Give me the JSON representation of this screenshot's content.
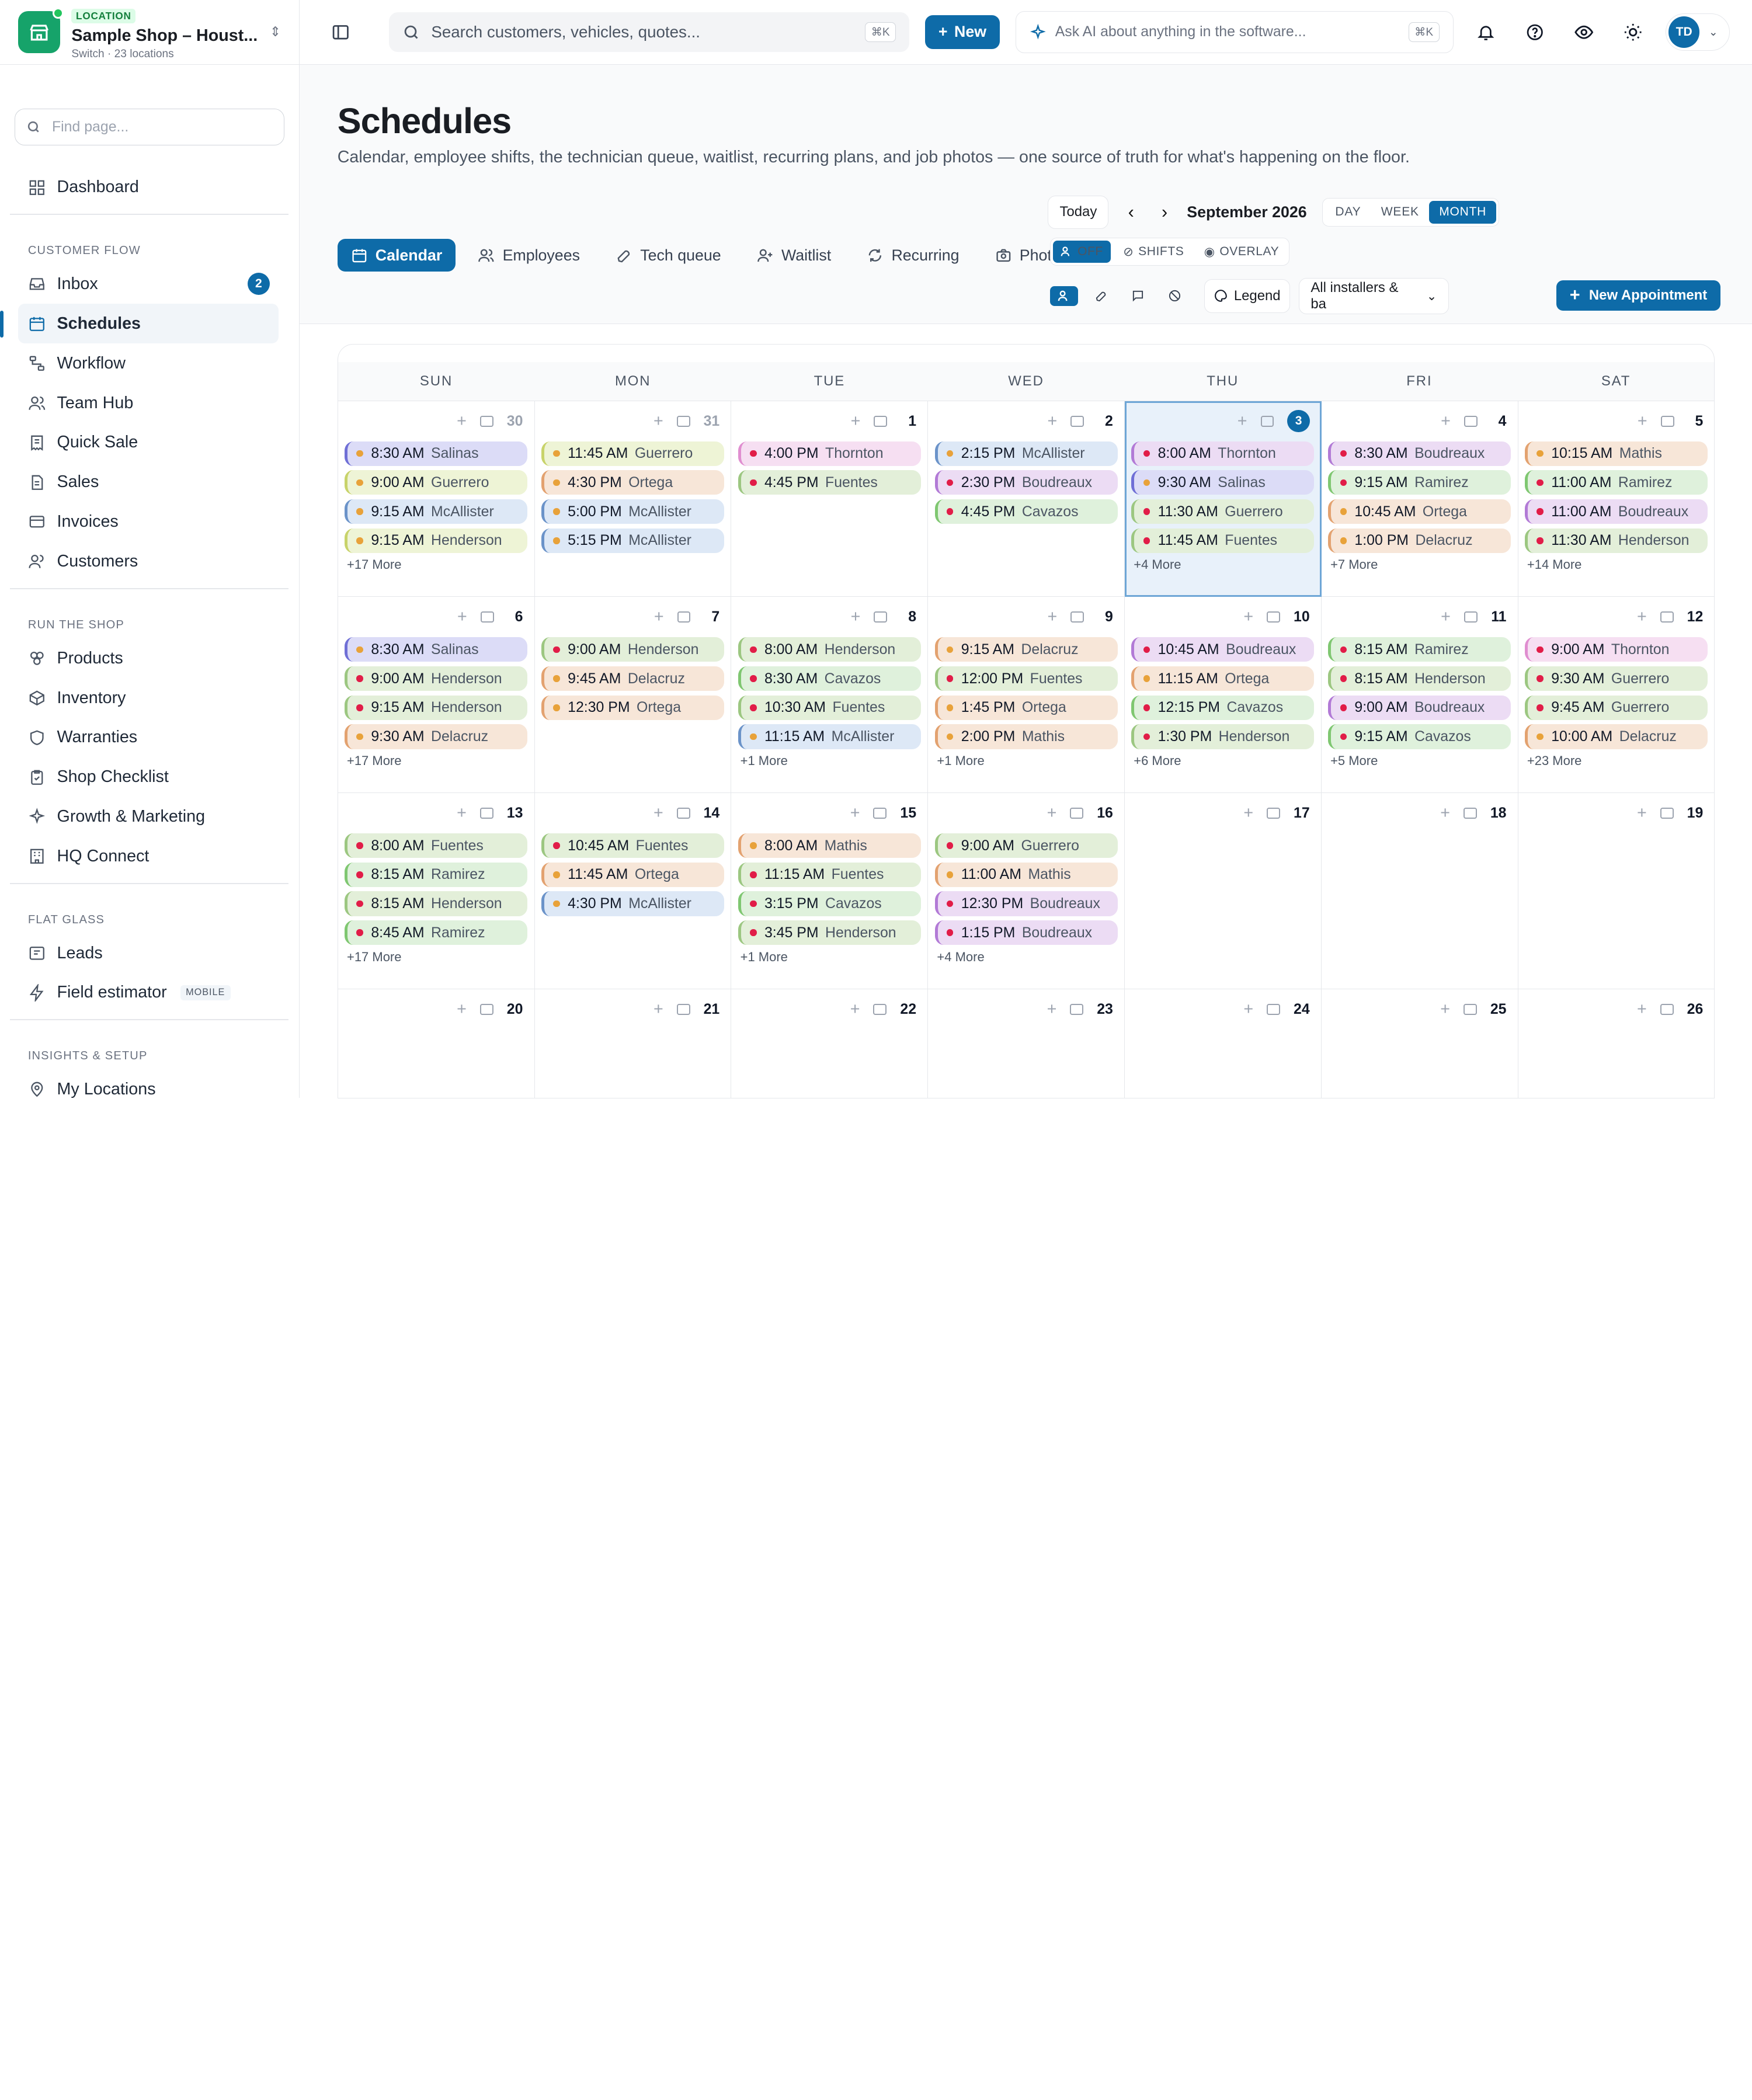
{
  "shop": {
    "badge": "LOCATION",
    "name": "Sample Shop – Houst...",
    "sub": "Switch · 23 locations"
  },
  "sidebar": {
    "find_placeholder": "Find page...",
    "top": [
      {
        "label": "Dashboard",
        "icon": "dashboard-icon"
      }
    ],
    "sections": [
      {
        "title": "CUSTOMER FLOW",
        "items": [
          {
            "label": "Inbox",
            "icon": "inbox-icon",
            "badge": "2"
          },
          {
            "label": "Schedules",
            "icon": "calendar-icon",
            "active": true
          },
          {
            "label": "Workflow",
            "icon": "workflow-icon"
          },
          {
            "label": "Team Hub",
            "icon": "users-icon"
          },
          {
            "label": "Quick Sale",
            "icon": "receipt-icon"
          },
          {
            "label": "Sales",
            "icon": "document-icon"
          },
          {
            "label": "Invoices",
            "icon": "card-icon"
          },
          {
            "label": "Customers",
            "icon": "customers-icon"
          }
        ]
      },
      {
        "title": "RUN THE SHOP",
        "items": [
          {
            "label": "Products",
            "icon": "products-icon"
          },
          {
            "label": "Inventory",
            "icon": "box-icon"
          },
          {
            "label": "Warranties",
            "icon": "shield-icon"
          },
          {
            "label": "Shop Checklist",
            "icon": "clipboard-icon"
          },
          {
            "label": "Growth & Marketing",
            "icon": "sparkle-icon"
          },
          {
            "label": "HQ Connect",
            "icon": "building-icon"
          }
        ]
      },
      {
        "title": "FLAT GLASS",
        "items": [
          {
            "label": "Leads",
            "icon": "leads-icon"
          },
          {
            "label": "Field estimator",
            "icon": "bolt-icon",
            "tag": "MOBILE"
          }
        ]
      },
      {
        "title": "INSIGHTS & SETUP",
        "items": [
          {
            "label": "My Locations",
            "icon": "pin-icon"
          }
        ]
      }
    ]
  },
  "topbar": {
    "search_placeholder": "Search customers, vehicles, quotes...",
    "search_kbd": "⌘K",
    "new_label": "New",
    "ai_placeholder": "Ask AI about anything in the software...",
    "ai_kbd": "⌘K",
    "avatar": "TD"
  },
  "page": {
    "title": "Schedules",
    "description": "Calendar, employee shifts, the technician queue, waitlist, recurring plans, and job photos — one source of truth for what's happening on the floor.",
    "today_label": "Today",
    "month_label": "September 2026",
    "views": [
      "DAY",
      "WEEK",
      "MONTH"
    ],
    "active_view": "MONTH",
    "tabs": [
      {
        "label": "Calendar",
        "icon": "calendar-icon",
        "active": true
      },
      {
        "label": "Employees",
        "icon": "users-icon"
      },
      {
        "label": "Tech queue",
        "icon": "wrench-icon"
      },
      {
        "label": "Waitlist",
        "icon": "user-plus-icon"
      },
      {
        "label": "Recurring",
        "icon": "refresh-icon"
      },
      {
        "label": "Photos",
        "icon": "camera-icon"
      }
    ],
    "modes": [
      "OFF",
      "SHIFTS",
      "OVERLAY"
    ],
    "legend_label": "Legend",
    "installer_filter": "All installers & ba",
    "new_appointment": "New Appointment"
  },
  "calendar": {
    "weekdays": [
      "SUN",
      "MON",
      "TUE",
      "WED",
      "THU",
      "FRI",
      "SAT"
    ],
    "colors": {
      "purple": {
        "bg": "#dcdcf7",
        "border": "#6f6fd6",
        "dot": "#e8a23a"
      },
      "yellow": {
        "bg": "#eef4d6",
        "border": "#c8d36a",
        "dot": "#e8a23a"
      },
      "blue": {
        "bg": "#dde8f6",
        "border": "#6b93c9",
        "dot": "#e8a23a"
      },
      "orange": {
        "bg": "#f7e6d8",
        "border": "#e3a270",
        "dot": "#e8a23a"
      },
      "pink": {
        "bg": "#f6dff2",
        "border": "#e08ed0",
        "dot": "#e11d48"
      },
      "lavender": {
        "bg": "#ecdcf4",
        "border": "#b27ad6",
        "dot": "#e11d48"
      },
      "green": {
        "bg": "#dff1dc",
        "border": "#7fc771",
        "dot": "#e11d48"
      },
      "mint": {
        "bg": "#e3efd9",
        "border": "#9cc781",
        "dot": "#e11d48"
      }
    },
    "weeks": [
      [
        {
          "day": "30",
          "muted": true,
          "appts": [
            [
              "8:30 AM",
              "Salinas",
              "purple"
            ],
            [
              "9:00 AM",
              "Guerrero",
              "yellow"
            ],
            [
              "9:15 AM",
              "McAllister",
              "blue"
            ],
            [
              "9:15 AM",
              "Henderson",
              "yellow"
            ]
          ],
          "more": "+17 More"
        },
        {
          "day": "31",
          "muted": true,
          "appts": [
            [
              "11:45 AM",
              "Guerrero",
              "yellow"
            ],
            [
              "4:30 PM",
              "Ortega",
              "orange"
            ],
            [
              "5:00 PM",
              "McAllister",
              "blue"
            ],
            [
              "5:15 PM",
              "McAllister",
              "blue"
            ]
          ],
          "more": ""
        },
        {
          "day": "1",
          "appts": [
            [
              "4:00 PM",
              "Thornton",
              "pink"
            ],
            [
              "4:45 PM",
              "Fuentes",
              "mint"
            ]
          ],
          "more": ""
        },
        {
          "day": "2",
          "appts": [
            [
              "2:15 PM",
              "McAllister",
              "blue"
            ],
            [
              "2:30 PM",
              "Boudreaux",
              "lavender"
            ],
            [
              "4:45 PM",
              "Cavazos",
              "green"
            ]
          ],
          "more": ""
        },
        {
          "day": "3",
          "today": true,
          "appts": [
            [
              "8:00 AM",
              "Thornton",
              "lavender"
            ],
            [
              "9:30 AM",
              "Salinas",
              "purple"
            ],
            [
              "11:30 AM",
              "Guerrero",
              "mint"
            ],
            [
              "11:45 AM",
              "Fuentes",
              "mint"
            ]
          ],
          "more": "+4 More"
        },
        {
          "day": "4",
          "appts": [
            [
              "8:30 AM",
              "Boudreaux",
              "lavender"
            ],
            [
              "9:15 AM",
              "Ramirez",
              "green"
            ],
            [
              "10:45 AM",
              "Ortega",
              "orange"
            ],
            [
              "1:00 PM",
              "Delacruz",
              "orange"
            ]
          ],
          "more": "+7 More"
        },
        {
          "day": "5",
          "appts": [
            [
              "10:15 AM",
              "Mathis",
              "orange"
            ],
            [
              "11:00 AM",
              "Ramirez",
              "green"
            ],
            [
              "11:00 AM",
              "Boudreaux",
              "lavender"
            ],
            [
              "11:30 AM",
              "Henderson",
              "mint"
            ]
          ],
          "more": "+14 More"
        }
      ],
      [
        {
          "day": "6",
          "appts": [
            [
              "8:30 AM",
              "Salinas",
              "purple"
            ],
            [
              "9:00 AM",
              "Henderson",
              "mint"
            ],
            [
              "9:15 AM",
              "Henderson",
              "mint"
            ],
            [
              "9:30 AM",
              "Delacruz",
              "orange"
            ]
          ],
          "more": "+17 More"
        },
        {
          "day": "7",
          "appts": [
            [
              "9:00 AM",
              "Henderson",
              "mint"
            ],
            [
              "9:45 AM",
              "Delacruz",
              "orange"
            ],
            [
              "12:30 PM",
              "Ortega",
              "orange"
            ]
          ],
          "more": ""
        },
        {
          "day": "8",
          "appts": [
            [
              "8:00 AM",
              "Henderson",
              "mint"
            ],
            [
              "8:30 AM",
              "Cavazos",
              "green"
            ],
            [
              "10:30 AM",
              "Fuentes",
              "mint"
            ],
            [
              "11:15 AM",
              "McAllister",
              "blue"
            ]
          ],
          "more": "+1 More"
        },
        {
          "day": "9",
          "appts": [
            [
              "9:15 AM",
              "Delacruz",
              "orange"
            ],
            [
              "12:00 PM",
              "Fuentes",
              "mint"
            ],
            [
              "1:45 PM",
              "Ortega",
              "orange"
            ],
            [
              "2:00 PM",
              "Mathis",
              "orange"
            ]
          ],
          "more": "+1 More"
        },
        {
          "day": "10",
          "appts": [
            [
              "10:45 AM",
              "Boudreaux",
              "lavender"
            ],
            [
              "11:15 AM",
              "Ortega",
              "orange"
            ],
            [
              "12:15 PM",
              "Cavazos",
              "green"
            ],
            [
              "1:30 PM",
              "Henderson",
              "mint"
            ]
          ],
          "more": "+6 More"
        },
        {
          "day": "11",
          "appts": [
            [
              "8:15 AM",
              "Ramirez",
              "green"
            ],
            [
              "8:15 AM",
              "Henderson",
              "mint"
            ],
            [
              "9:00 AM",
              "Boudreaux",
              "lavender"
            ],
            [
              "9:15 AM",
              "Cavazos",
              "green"
            ]
          ],
          "more": "+5 More"
        },
        {
          "day": "12",
          "appts": [
            [
              "9:00 AM",
              "Thornton",
              "pink"
            ],
            [
              "9:30 AM",
              "Guerrero",
              "mint"
            ],
            [
              "9:45 AM",
              "Guerrero",
              "mint"
            ],
            [
              "10:00 AM",
              "Delacruz",
              "orange"
            ]
          ],
          "more": "+23 More"
        }
      ],
      [
        {
          "day": "13",
          "appts": [
            [
              "8:00 AM",
              "Fuentes",
              "mint"
            ],
            [
              "8:15 AM",
              "Ramirez",
              "green"
            ],
            [
              "8:15 AM",
              "Henderson",
              "mint"
            ],
            [
              "8:45 AM",
              "Ramirez",
              "green"
            ]
          ],
          "more": "+17 More"
        },
        {
          "day": "14",
          "appts": [
            [
              "10:45 AM",
              "Fuentes",
              "mint"
            ],
            [
              "11:45 AM",
              "Ortega",
              "orange"
            ],
            [
              "4:30 PM",
              "McAllister",
              "blue"
            ]
          ],
          "more": ""
        },
        {
          "day": "15",
          "appts": [
            [
              "8:00 AM",
              "Mathis",
              "orange"
            ],
            [
              "11:15 AM",
              "Fuentes",
              "mint"
            ],
            [
              "3:15 PM",
              "Cavazos",
              "green"
            ],
            [
              "3:45 PM",
              "Henderson",
              "mint"
            ]
          ],
          "more": "+1 More"
        },
        {
          "day": "16",
          "appts": [
            [
              "9:00 AM",
              "Guerrero",
              "mint"
            ],
            [
              "11:00 AM",
              "Mathis",
              "orange"
            ],
            [
              "12:30 PM",
              "Boudreaux",
              "lavender"
            ],
            [
              "1:15 PM",
              "Boudreaux",
              "lavender"
            ]
          ],
          "more": "+4 More"
        },
        {
          "day": "17",
          "appts": [],
          "more": ""
        },
        {
          "day": "18",
          "appts": [],
          "more": ""
        },
        {
          "day": "19",
          "appts": [],
          "more": ""
        }
      ],
      [
        {
          "day": "20",
          "appts": [],
          "more": ""
        },
        {
          "day": "21",
          "appts": [],
          "more": ""
        },
        {
          "day": "22",
          "appts": [],
          "more": ""
        },
        {
          "day": "23",
          "appts": [],
          "more": ""
        },
        {
          "day": "24",
          "appts": [],
          "more": ""
        },
        {
          "day": "25",
          "appts": [],
          "more": ""
        },
        {
          "day": "26",
          "appts": [],
          "more": ""
        }
      ]
    ]
  }
}
